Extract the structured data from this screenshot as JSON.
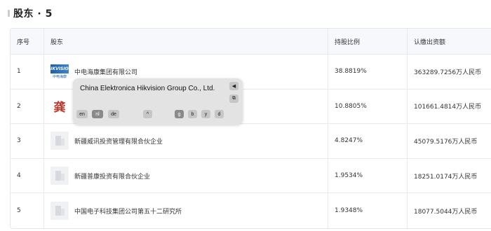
{
  "section": {
    "title": "股东 · 5"
  },
  "table": {
    "headers": {
      "index": "序号",
      "name": "股东",
      "ratio": "持股比例",
      "capital": "认缴出资额"
    },
    "rows": [
      {
        "index": "1",
        "name": "中电海康集团有限公司",
        "ratio": "38.8819%",
        "capital": "363289.7256万人民币",
        "logo": "hikvision-logo"
      },
      {
        "index": "2",
        "name": "",
        "ratio": "10.8805%",
        "capital": "101661.4814万人民币",
        "logo": "gong-logo",
        "logo_text": "龚"
      },
      {
        "index": "3",
        "name": "新疆威讯投资管理有限合伙企业",
        "ratio": "4.8247%",
        "capital": "45079.5176万人民币",
        "logo": "building-icon"
      },
      {
        "index": "4",
        "name": "新疆普康投资有限合伙企业",
        "ratio": "1.9534%",
        "capital": "18251.0174万人民币",
        "logo": "building-icon"
      },
      {
        "index": "5",
        "name": "中国电子科技集团公司第五十二研究所",
        "ratio": "1.9348%",
        "capital": "18077.5044万人民币",
        "logo": "building-icon"
      }
    ]
  },
  "logo_hik": {
    "top": "HIKVISION",
    "bottom": "中电海康"
  },
  "popup": {
    "text": "China Elektronica Hikvision Group Co., Ltd.",
    "speaker_icon": "◀",
    "copy_icon": "⧉",
    "lang_buttons": [
      "en",
      "nl",
      "de"
    ],
    "up_icon": "^",
    "letter_buttons": [
      "g",
      "b",
      "y",
      "d"
    ]
  }
}
